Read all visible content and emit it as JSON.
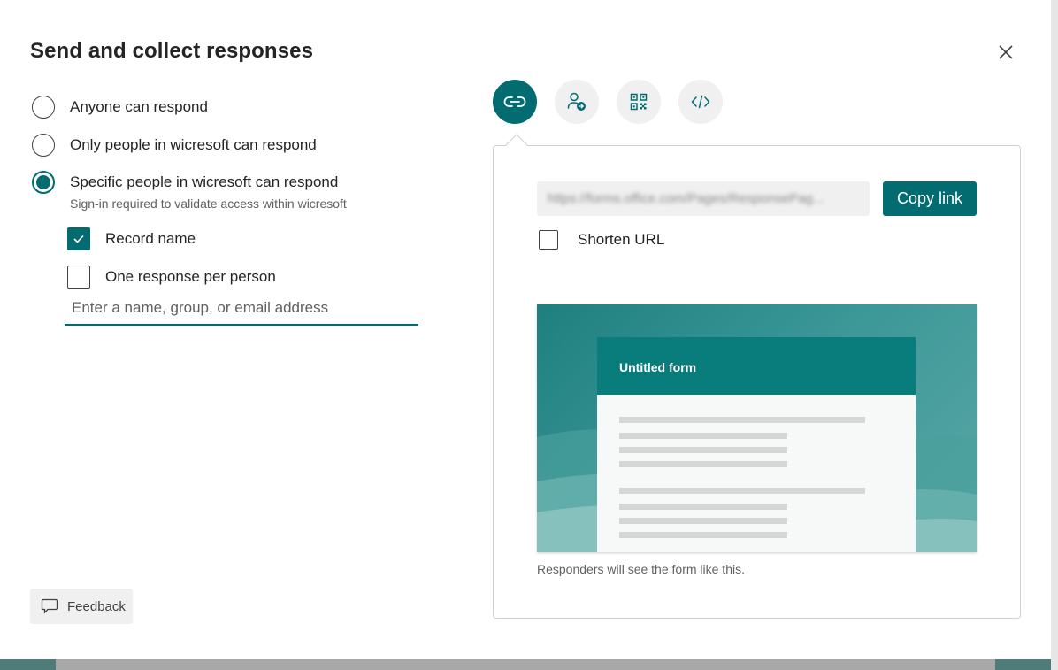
{
  "dialog": {
    "title": "Send and collect responses",
    "close_icon": "close-icon"
  },
  "audience": {
    "options": [
      {
        "label": "Anyone can respond",
        "selected": false
      },
      {
        "label": "Only people in wicresoft can respond",
        "selected": false
      },
      {
        "label": "Specific people in wicresoft can respond",
        "selected": true
      }
    ],
    "hint": "Sign-in required to validate access within wicresoft",
    "record_name": {
      "label": "Record name",
      "checked": true
    },
    "one_response": {
      "label": "One response per person",
      "checked": false
    },
    "people_input": {
      "value": "",
      "placeholder": "Enter a name, group, or email address"
    }
  },
  "tabs": [
    {
      "name": "link-tab",
      "icon": "link-icon",
      "active": true
    },
    {
      "name": "invite-tab",
      "icon": "person-arrow-icon",
      "active": false
    },
    {
      "name": "qr-code-tab",
      "icon": "qr-code-icon",
      "active": false
    },
    {
      "name": "embed-tab",
      "icon": "code-icon",
      "active": false
    }
  ],
  "link": {
    "url": "https://forms.office.com/Pages/ResponsePag...",
    "copy_label": "Copy link",
    "shorten_label": "Shorten URL",
    "shorten_checked": false
  },
  "preview": {
    "form_title": "Untitled form",
    "caption": "Responders will see the form like this."
  },
  "feedback": {
    "label": "Feedback",
    "icon": "comment-icon"
  },
  "colors": {
    "accent": "#036c70",
    "preview_header": "#097c7c"
  }
}
